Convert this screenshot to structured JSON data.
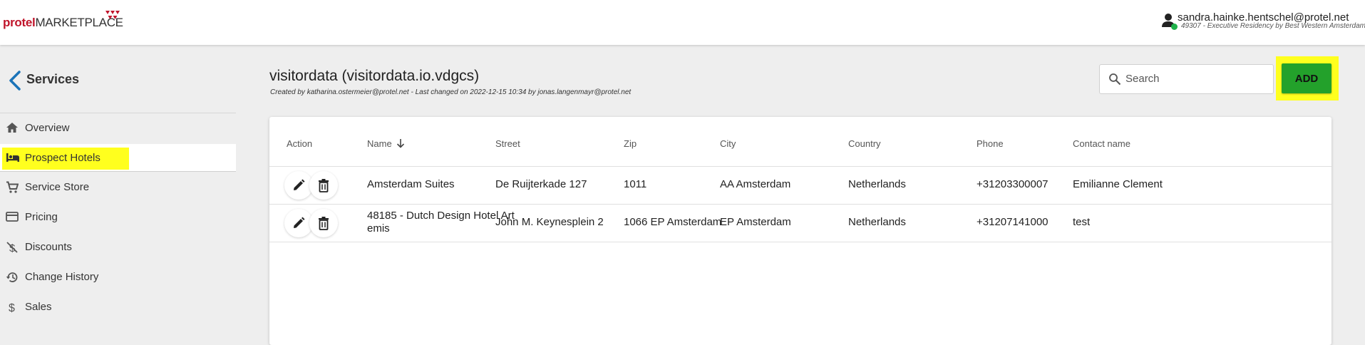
{
  "header": {
    "logo_brand": "protel",
    "logo_market": "MARKETPLACE",
    "user_email": "sandra.hainke.hentschel@protel.net",
    "user_hotel": "49307 - Executive Residency by Best Western Amsterdam",
    "status_color": "#1fb24a"
  },
  "sidebar": {
    "title": "Services",
    "items": [
      {
        "label": "Overview",
        "icon": "home-icon"
      },
      {
        "label": "Prospect Hotels",
        "icon": "hotel-bed-icon",
        "active": true
      },
      {
        "label": "Service Store",
        "icon": "cart-icon"
      },
      {
        "label": "Pricing",
        "icon": "credit-card-icon"
      },
      {
        "label": "Discounts",
        "icon": "money-off-icon"
      },
      {
        "label": "Change History",
        "icon": "history-icon"
      },
      {
        "label": "Sales",
        "icon": "dollar-icon"
      }
    ]
  },
  "main": {
    "title": "visitordata (visitordata.io.vdgcs)",
    "meta": "Created by katharina.ostermeier@protel.net - Last changed on 2022-12-15 10:34 by jonas.langenmayr@protel.net",
    "search_placeholder": "Search",
    "add_label": "ADD",
    "highlight_color": "#ffff1e",
    "accent_color": "#23a12b"
  },
  "table": {
    "columns": [
      "Action",
      "Name",
      "Street",
      "Zip",
      "City",
      "Country",
      "Phone",
      "Contact name"
    ],
    "sorted_column": "Name",
    "sort_direction": "descending",
    "rows": [
      {
        "name": "Amsterdam Suites",
        "street": "De Ruijterkade 127",
        "zip": "1011",
        "city": "AA Amsterdam",
        "country": "Netherlands",
        "phone": "+31203300007",
        "contact": "Emilianne Clement"
      },
      {
        "name": "48185 - Dutch Design Hotel Art emis",
        "street": "John M. Keynesplein 2",
        "zip": "1066 EP Amsterdam",
        "city": "EP Amsterdam",
        "country": "Netherlands",
        "phone": "+31207141000",
        "contact": "test"
      }
    ]
  }
}
